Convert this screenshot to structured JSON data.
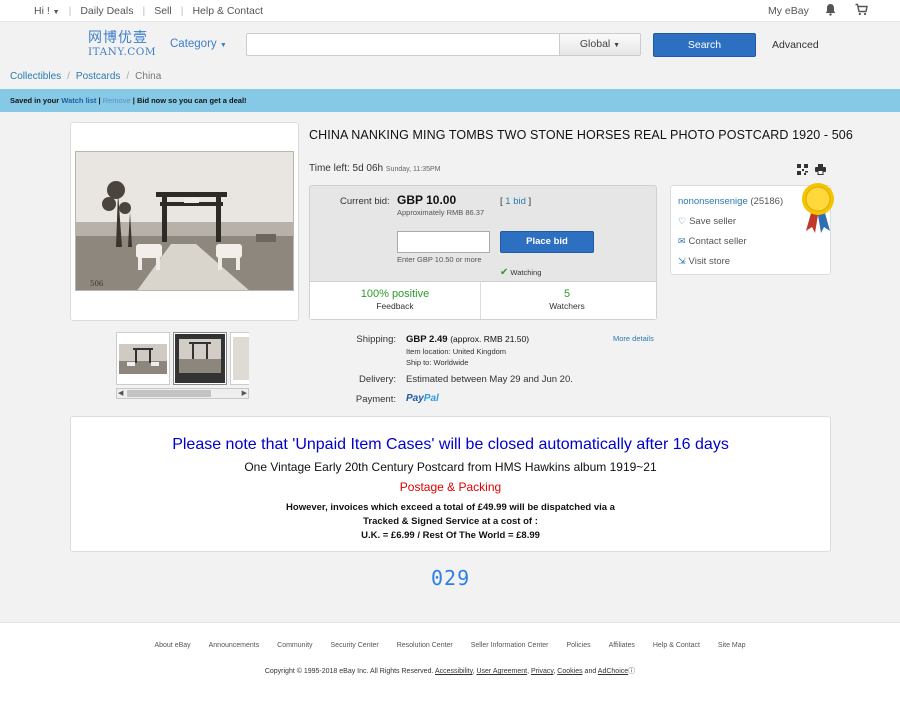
{
  "topbar": {
    "greeting": "Hi !",
    "daily_deals": "Daily Deals",
    "sell": "Sell",
    "help": "Help & Contact",
    "my_ebay": "My eBay"
  },
  "header": {
    "logo_cn": "网博优壹",
    "logo_en": "ITANY.COM",
    "category": "Category",
    "search_placeholder": "",
    "global": "Global",
    "search_button": "Search",
    "advanced": "Advanced"
  },
  "breadcrumb": [
    "Collectibles",
    "Postcards",
    "China"
  ],
  "watchbar": {
    "prefix": "Saved in your",
    "watch_list": "Watch list",
    "remove": "Remove",
    "suffix": "Bid now so you can get a deal!"
  },
  "item": {
    "title": "CHINA NANKING MING TOMBS TWO STONE HORSES REAL PHOTO POSTCARD 1920 - 506",
    "time_left_label": "Time left:",
    "time_left": "5d 06h",
    "time_end": "Sunday, 11:35PM",
    "current_bid_label": "Current bid:",
    "current_bid": "GBP 10.00",
    "approx": "Approximately RMB 86.37",
    "bid_count": "1 bid",
    "place_bid": "Place bid",
    "enter_note": "Enter GBP 10.50 or more",
    "watching": "Watching",
    "positive_value": "100% positive",
    "positive_label": "Feedback",
    "watchers_value": "5",
    "watchers_label": "Watchers"
  },
  "seller": {
    "name": "nononsensenige",
    "score": "(25186)",
    "save": "Save seller",
    "contact": "Contact seller",
    "store": "Visit store"
  },
  "shipping": {
    "shipping_label": "Shipping:",
    "price": "GBP 2.49",
    "approx": "(approx. RMB 21.50)",
    "location": "Item location: United Kingdom",
    "ship_to": "Ship to: Worldwide",
    "more_details": "More details",
    "delivery_label": "Delivery:",
    "delivery": "Estimated between May 29 and Jun 20.",
    "payment_label": "Payment:",
    "paypal_a": "Pay",
    "paypal_b": "Pal"
  },
  "description": {
    "notice": "Please note that 'Unpaid Item Cases' will be closed automatically after 16 days",
    "headline": "One Vintage Early 20th Century Postcard from HMS Hawkins album 1919~21",
    "postage": "Postage & Packing",
    "line1": "However, invoices which exceed a total of £49.99 will be dispatched via a",
    "line2": "Tracked & Signed Service at a cost of :",
    "line3": "U.K. = £6.99 / Rest Of The World = £8.99"
  },
  "counter": "029",
  "footer": {
    "links": [
      "About eBay",
      "Announcements",
      "Community",
      "Security Center",
      "Resolution Center",
      "Seller Information Center",
      "Policies",
      "Affiliates",
      "Help & Contact",
      "Site Map"
    ],
    "copyright": "Copyright © 1995-2018 eBay Inc. All Rights Reserved.",
    "legal": [
      "Accessibility",
      "User Agreement",
      "Privacy",
      "Cookies"
    ],
    "and": "and",
    "adchoice": "AdChoice"
  },
  "colors": {
    "accent_blue": "#2d6fc1",
    "watchbar": "#86c9e6",
    "positive_green": "#2c9b2c",
    "notice_blue": "#0000cc",
    "postage_red": "#e00000"
  }
}
